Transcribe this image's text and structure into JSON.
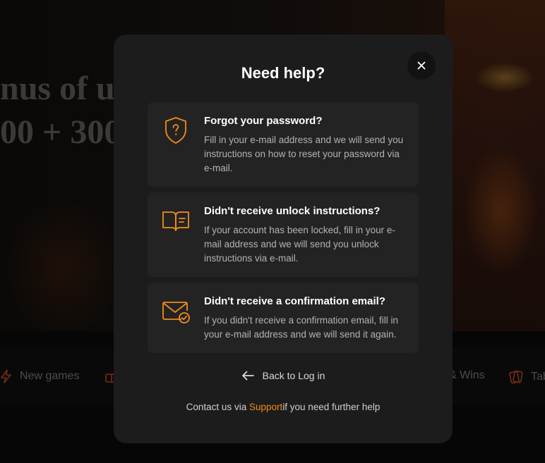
{
  "background": {
    "hero_line1": "nus of u",
    "hero_line2": "00 + 300",
    "nav": [
      {
        "label": "New games",
        "icon": "lightning-icon"
      },
      {
        "label": "",
        "icon": "gift-icon"
      },
      {
        "label": "& Wins",
        "icon": ""
      },
      {
        "label": "Tab",
        "icon": "cards-icon"
      }
    ]
  },
  "modal": {
    "title": "Need help?",
    "close_icon": "close-icon",
    "options": [
      {
        "icon": "shield-question-icon",
        "title": "Forgot your password?",
        "description": "Fill in your e-mail address and we will send you instructions on how to reset your password via e-mail."
      },
      {
        "icon": "open-book-icon",
        "title": "Didn't receive unlock instructions?",
        "description": "If your account has been locked, fill in your e-mail address and we will send you unlock instructions via e-mail."
      },
      {
        "icon": "envelope-check-icon",
        "title": "Didn't receive a confirmation email?",
        "description": "If you didn't receive a confirmation email, fill in your e-mail address and we will send it again."
      }
    ],
    "back_label": "Back to Log in",
    "contact_prefix": "Contact us via ",
    "support_label": "Support",
    "contact_suffix": "if you need further help"
  },
  "colors": {
    "accent": "#f28c1c",
    "modal_bg": "#1c1c1c",
    "card_bg": "#232323"
  }
}
